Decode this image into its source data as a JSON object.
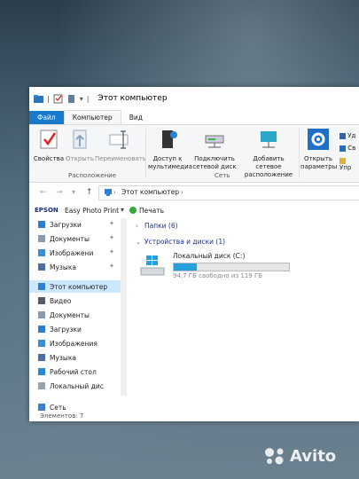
{
  "window": {
    "title": "Этот компьютер"
  },
  "tabs": [
    "Файл",
    "Компьютер",
    "Вид"
  ],
  "ribbon": {
    "location": {
      "props": "Свойства",
      "open": "Открыть",
      "rename": "Переименовать",
      "label": "Расположение"
    },
    "network": {
      "media_1": "Доступ к",
      "media_2": "мультимедиа",
      "map_1": "Подключить",
      "map_2": "сетевой диск",
      "add_1": "Добавить сетевое",
      "add_2": "расположение",
      "label": "Сеть"
    },
    "system": {
      "settings_1": "Открыть",
      "settings_2": "параметры",
      "u1": "Уд",
      "u2": "Св",
      "u3": "Упр"
    }
  },
  "address": {
    "back": "←",
    "forward": "→",
    "up": "↑",
    "path": "Этот компьютер"
  },
  "cmdbar": {
    "epson": "EPSON",
    "easy_print": "Easy Photo Print",
    "print": "Печать"
  },
  "nav": [
    {
      "label": "Загрузки",
      "icon": "download-icon",
      "pinned": true
    },
    {
      "label": "Документы",
      "icon": "documents-icon",
      "pinned": true
    },
    {
      "label": "Изображени",
      "icon": "pictures-icon",
      "pinned": true
    },
    {
      "label": "Музыка",
      "icon": "music-icon",
      "pinned": true
    },
    {
      "label": "Этот компьютер",
      "icon": "computer-icon",
      "pinned": false,
      "selected": true
    },
    {
      "label": "Видео",
      "icon": "video-icon"
    },
    {
      "label": "Документы",
      "icon": "documents-icon"
    },
    {
      "label": "Загрузки",
      "icon": "download-icon"
    },
    {
      "label": "Изображения",
      "icon": "pictures-icon"
    },
    {
      "label": "Музыка",
      "icon": "music-icon"
    },
    {
      "label": "Рабочий стол",
      "icon": "desktop-icon"
    },
    {
      "label": "Локальный дис",
      "icon": "drive-icon"
    },
    {
      "label": "Сеть",
      "icon": "network-icon"
    }
  ],
  "main": {
    "folders": "Папки (6)",
    "devices": "Устройства и диски (1)",
    "drive": {
      "name": "Локальный диск (C:)",
      "free": "94,7 ГБ свободно из 119 ГБ",
      "used_fraction": 0.2
    }
  },
  "status": {
    "items": "Элементов: 7"
  },
  "watermark": "Avito"
}
